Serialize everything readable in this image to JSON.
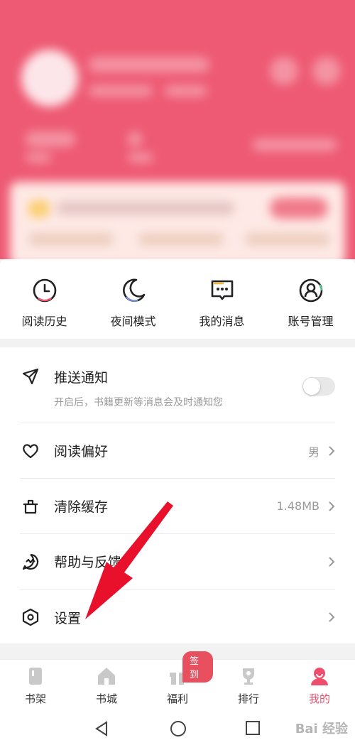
{
  "quick_actions": [
    {
      "label": "阅读历史",
      "icon": "clock-icon"
    },
    {
      "label": "夜间模式",
      "icon": "moon-icon"
    },
    {
      "label": "我的消息",
      "icon": "message-icon"
    },
    {
      "label": "账号管理",
      "icon": "account-icon"
    }
  ],
  "settings": [
    {
      "title": "推送通知",
      "subtitle": "开启后，书籍更新等消息会及时通知您",
      "icon": "paper-plane-icon",
      "toggle_on": false
    },
    {
      "title": "阅读偏好",
      "value": "男",
      "icon": "heart-icon"
    },
    {
      "title": "清除缓存",
      "value": "1.48MB",
      "icon": "pot-icon"
    },
    {
      "title": "帮助与反馈",
      "icon": "help-feedback-icon"
    },
    {
      "title": "设置",
      "icon": "hexagon-settings-icon"
    }
  ],
  "tabs": [
    {
      "label": "书架",
      "icon": "bookshelf-icon"
    },
    {
      "label": "书城",
      "icon": "home-icon"
    },
    {
      "label": "福利",
      "icon": "gift-icon",
      "badge": "签到"
    },
    {
      "label": "排行",
      "icon": "trophy-icon"
    },
    {
      "label": "我的",
      "icon": "profile-icon",
      "active": true
    }
  ],
  "watermark": "Bai 经验",
  "colors": {
    "accent": "#ee4d6b",
    "header": "#ee5a73",
    "annotation_arrow": "#e8102a"
  }
}
